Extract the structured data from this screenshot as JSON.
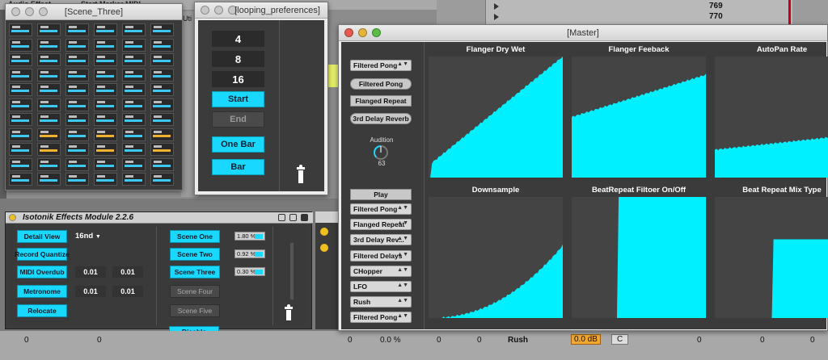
{
  "background": {
    "left_browser": {
      "label_top": "Audio Effect",
      "label_mid": "Start Marker MIDI",
      "label_ut": "Uti"
    },
    "clip_rows": [
      {
        "value": "769"
      },
      {
        "value": "770"
      }
    ]
  },
  "scene_three": {
    "title": "[Scene_Three]"
  },
  "looping": {
    "title": "[looping_preferences]",
    "numbers": [
      "4",
      "8",
      "16"
    ],
    "start_label": "Start",
    "end_label": "End",
    "one_bar_label": "One Bar",
    "bar_label": "Bar"
  },
  "master": {
    "title": "[Master]",
    "dropdown_top": "Filtered Pong",
    "buttons": [
      "Filtered Pong",
      "Flanged Repeat",
      "3rd Delay Reverb"
    ],
    "audition": {
      "label": "Audition",
      "value": "63",
      "level": 0.5
    },
    "play_label": "Play",
    "dropdowns": [
      "Filtered Pong",
      "Flanged Repeat",
      "3rd Delay Rev...",
      "Filtered Delays",
      "CHopper",
      "LFO",
      "Rush",
      "Filtered Pong"
    ],
    "plots": [
      {
        "title": "Flanger Dry Wet"
      },
      {
        "title": "Flanger Feeback"
      },
      {
        "title": "AutoPan Rate"
      },
      {
        "title": "Downsample"
      },
      {
        "title": "BeatRepeat Filtoer On/Off"
      },
      {
        "title": "Beat Repeat Mix Type"
      }
    ],
    "colors": {
      "plot_fill": "#00f0ff",
      "plot_bg": "#444444"
    }
  },
  "isotonik": {
    "title": "Isotonik Effects Module 2.2.6",
    "detail_view": "Detail View",
    "rate": "16nd",
    "record_quantize": "Record Quantize",
    "midi_overdub": "MIDI Overdub",
    "metronome": "Metronome",
    "relocate": "Relocate",
    "values": [
      "0.01",
      "0.01",
      "0.01",
      "0.01"
    ],
    "scenes": [
      "Scene One",
      "Scene Two",
      "Scene Three",
      "Scene Four",
      "Scene Five"
    ],
    "disable": "Disable",
    "percents": [
      "1.80 %",
      "0.92 %",
      "0.30 %"
    ]
  },
  "bottom": {
    "vals": [
      "0",
      "0",
      "0.0 %",
      "0",
      "0",
      "0",
      "Rush",
      "0.0 dB",
      "C",
      "0",
      "0",
      "0"
    ]
  },
  "colors": {
    "accent": "#18d8ff"
  }
}
